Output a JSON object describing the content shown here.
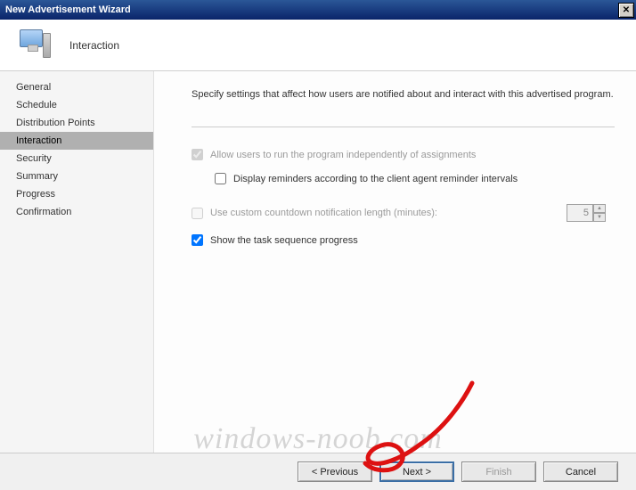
{
  "window": {
    "title": "New Advertisement Wizard",
    "close_glyph": "✕"
  },
  "header": {
    "title": "Interaction"
  },
  "sidebar": {
    "items": [
      {
        "label": "General",
        "selected": false
      },
      {
        "label": "Schedule",
        "selected": false
      },
      {
        "label": "Distribution Points",
        "selected": false
      },
      {
        "label": "Interaction",
        "selected": true
      },
      {
        "label": "Security",
        "selected": false
      },
      {
        "label": "Summary",
        "selected": false
      },
      {
        "label": "Progress",
        "selected": false
      },
      {
        "label": "Confirmation",
        "selected": false
      }
    ]
  },
  "content": {
    "description": "Specify settings that affect how users are notified about and interact with this advertised program.",
    "options": {
      "allow_run_label": "Allow users to run the program independently of assignments",
      "allow_run_checked": true,
      "allow_run_enabled": false,
      "display_reminders_label": "Display reminders according to the client agent reminder intervals",
      "display_reminders_checked": false,
      "display_reminders_enabled": true,
      "custom_countdown_label": "Use custom countdown notification length (minutes):",
      "custom_countdown_checked": false,
      "custom_countdown_enabled": false,
      "custom_countdown_value": "5",
      "show_progress_label": "Show the task sequence progress",
      "show_progress_checked": true,
      "show_progress_enabled": true
    }
  },
  "footer": {
    "previous": "< Previous",
    "next": "Next >",
    "finish": "Finish",
    "cancel": "Cancel"
  },
  "watermark": "windows-noob.com"
}
